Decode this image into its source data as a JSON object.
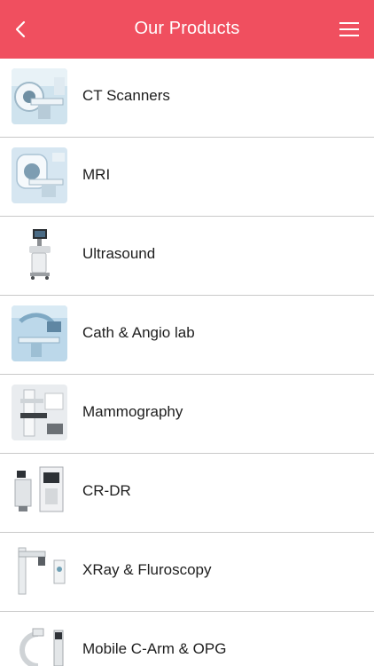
{
  "header": {
    "title": "Our Products",
    "back_icon": "chevron-left-icon",
    "menu_icon": "hamburger-menu-icon"
  },
  "colors": {
    "header_bg": "#f04f5f",
    "header_text": "#ffffff",
    "divider": "#c9c9c9"
  },
  "products": [
    {
      "label": "CT Scanners",
      "image": "ct-scanner-thumbnail"
    },
    {
      "label": "MRI",
      "image": "mri-thumbnail"
    },
    {
      "label": "Ultrasound",
      "image": "ultrasound-thumbnail"
    },
    {
      "label": "Cath & Angio lab",
      "image": "cath-angio-lab-thumbnail"
    },
    {
      "label": "Mammography",
      "image": "mammography-thumbnail"
    },
    {
      "label": "CR-DR",
      "image": "cr-dr-thumbnail"
    },
    {
      "label": "XRay & Fluroscopy",
      "image": "xray-fluroscopy-thumbnail"
    },
    {
      "label": "Mobile C-Arm & OPG",
      "image": "mobile-c-arm-opg-thumbnail"
    }
  ]
}
